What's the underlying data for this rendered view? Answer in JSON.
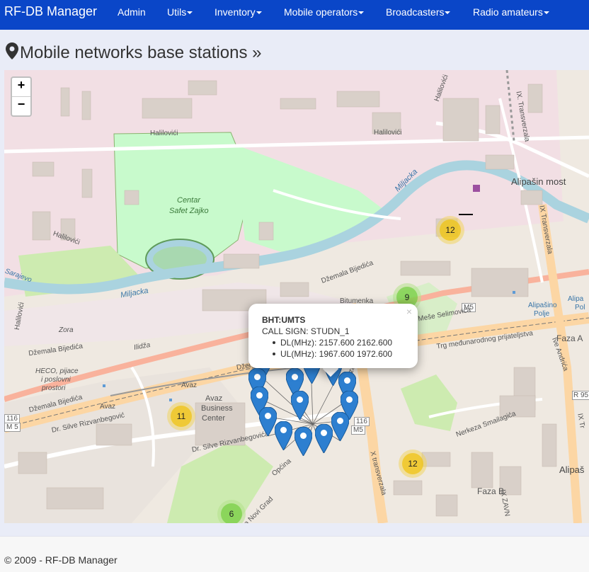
{
  "navbar": {
    "brand": "RF-DB Manager",
    "items": [
      {
        "label": "Admin",
        "dropdown": false
      },
      {
        "label": "Utils",
        "dropdown": true
      },
      {
        "label": "Inventory",
        "dropdown": true
      },
      {
        "label": "Mobile operators",
        "dropdown": true
      },
      {
        "label": "Broadcasters",
        "dropdown": true
      },
      {
        "label": "Radio amateurs",
        "dropdown": true
      }
    ]
  },
  "page": {
    "title": "Mobile networks base stations »",
    "title_icon": "map-marker-icon"
  },
  "map": {
    "zoom_in": "+",
    "zoom_out": "−",
    "clusters": [
      {
        "count": "12",
        "color": "yellow"
      },
      {
        "count": "9",
        "color": "green"
      },
      {
        "count": "11",
        "color": "yellow"
      },
      {
        "count": "12",
        "color": "yellow"
      },
      {
        "count": "6",
        "color": "green"
      }
    ],
    "popup": {
      "close": "×",
      "title": "BHT:UMTS",
      "call_sign": "CALL SIGN: STUDN_1",
      "dl": "DL(MHz): 2157.600 2162.600",
      "ul": "UL(MHz): 1967.600 1972.600"
    },
    "labels": {
      "hallovici_1": "Halilovići",
      "hallovici_2": "Halilovići",
      "hallovici_3": "Halilovići",
      "hallovici_4": "Halilovići",
      "hallovici_5": "Halilovići",
      "centar_1": "Centar",
      "centar_2": "Safet Zajko",
      "miljacka_1": "Miljacka",
      "miljacka_2": "Miljacka",
      "alipasin_most": "Alipašin most",
      "transverzala_9": "IX. Transverzala",
      "transverzala_1": "IX Transverzala",
      "dzemala_1": "Džemala Bijedića",
      "dzemala_2": "Džemala Bijedića",
      "dzemala_3": "Džemala Bijedića",
      "dzemala_4": "Džem",
      "zora": "Zora",
      "ilidza": "Ilidža",
      "heco_1": "HECO, pijace",
      "heco_2": "i poslovni",
      "heco_3": "prostori",
      "avaz_1": "Avaz",
      "avaz_2": "Avaz",
      "avaz_bc_1": "Avaz",
      "avaz_bc_2": "Business",
      "avaz_bc_3": "Center",
      "rizvanbegovica_1": "Dr. Silve Rizvanbegović",
      "rizvanbegovica_2": "Dr. Silve Rizvanbegovića",
      "sarajevo": "Sarajevo",
      "m5_1": "M5",
      "m5_2": "M5",
      "m5_3": "M 5",
      "m116_1": "116",
      "m116_2": "116",
      "mese": "Meše Selimovića",
      "trg": "Trg međunarodnog prijateljstva",
      "alipasino_polje_1": "Alipašino",
      "alipasino_polje_2": "Polje",
      "alipasino_polje_3": "Alipa",
      "alipasino_polje_4": "Pol",
      "faza_a": "Faza A",
      "faza_b": "Faza B",
      "ive_andrica": "Ive Andrića",
      "nerkeza": "Nerkeza Smailagića",
      "x_transverzala": "X transverzala",
      "opcina": "Općina",
      "novi_grad": "na Novi Grad",
      "bitumenka": "Bitumenka",
      "r95": "R 95",
      "ix_tr_right": "IX Tr",
      "ix_zavn": "IX ZAVN",
      "alipas_right": "Alipaš",
      "verzala": "verzala"
    }
  },
  "footer": {
    "text": "© 2009 - RF-DB Manager"
  },
  "colors": {
    "navbar": "#0a46c8",
    "marker": "#2d7fd0",
    "river": "#aad3df",
    "park": "#c8facc",
    "grass": "#cdebb0",
    "building": "#d9d0c9",
    "road_trunk": "#fcd6a4",
    "road_primary": "#f7fabf"
  }
}
